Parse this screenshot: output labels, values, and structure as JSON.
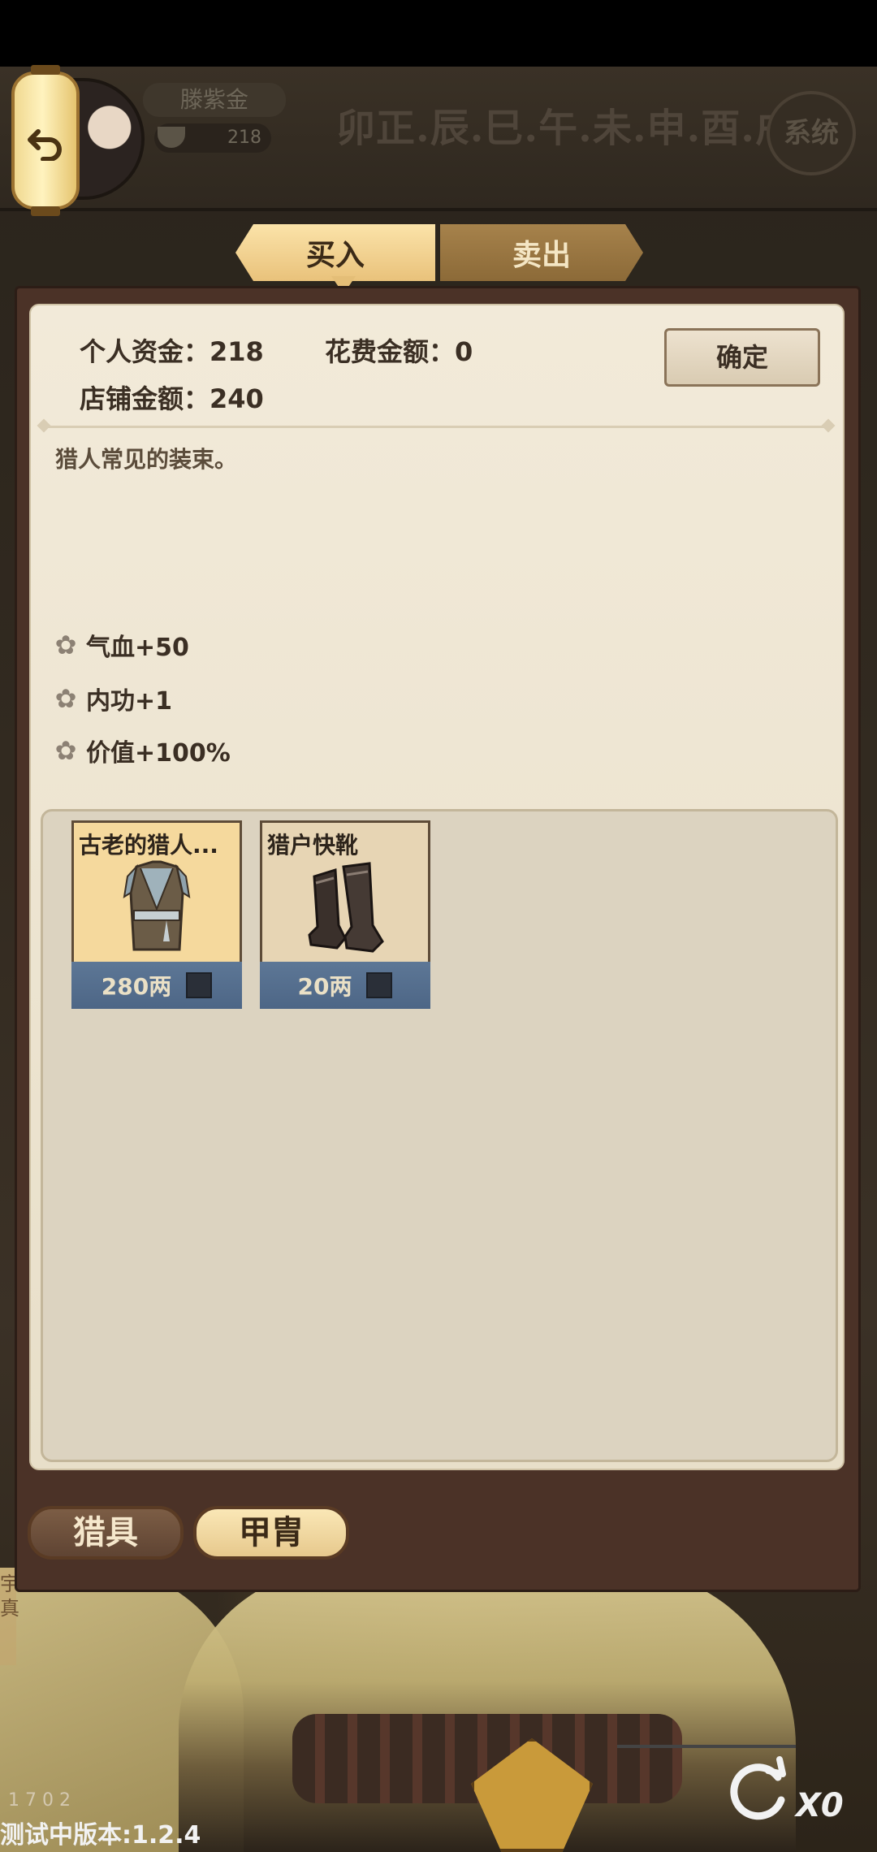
{
  "header": {
    "player_name": "滕紫金",
    "player_money": "218",
    "era_text": "卯正.辰.巳.午.未.申.酉.戌",
    "system_label": "系统"
  },
  "tabs": [
    {
      "label": "买入"
    },
    {
      "label": "卖出"
    }
  ],
  "shop": {
    "personal_funds_label": "个人资金：218",
    "spend_amount_label": "花费金额：0",
    "shop_funds_label": "店铺金额：240",
    "confirm_label": "确定",
    "description": "猎人常见的装束。",
    "attributes": [
      {
        "text": "气血+50",
        "icon": "flower-icon"
      },
      {
        "text": "内功+1",
        "icon": "flower-icon"
      },
      {
        "text": "价值+100%",
        "icon": "flower-icon"
      }
    ],
    "items": [
      {
        "name": "古老的猎人...",
        "price": "280两",
        "image": "vest-icon"
      },
      {
        "name": "猎户快靴",
        "price": "20两",
        "image": "boots-icon"
      }
    ]
  },
  "categories": [
    {
      "label": "猎具"
    },
    {
      "label": "甲胄"
    }
  ],
  "hud": {
    "refresh_count": "X0",
    "version": "测试中版本:1.2.4",
    "mini_stats": "1  7      0   2"
  },
  "background_side_text": "宇\n真",
  "colors": {
    "accent_gold": "#e9c27b",
    "panel_border": "#4b3227",
    "price_bar": "#5d7796"
  }
}
